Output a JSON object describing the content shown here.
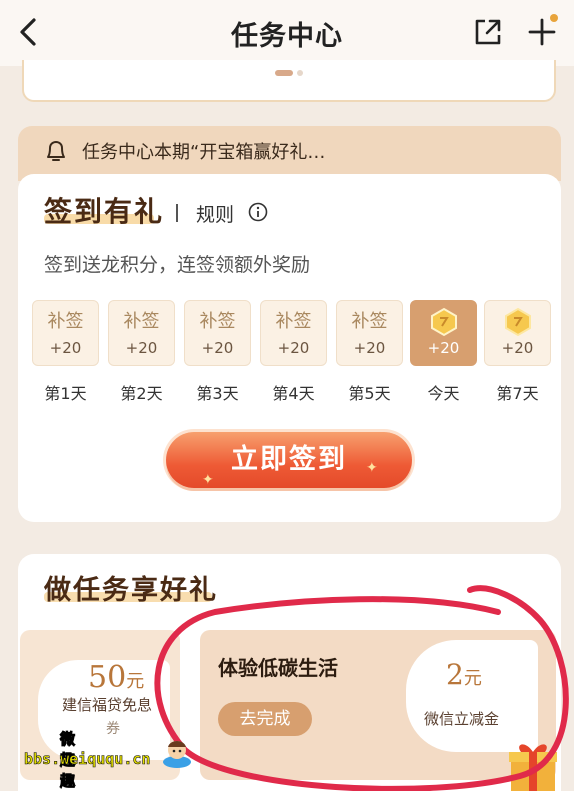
{
  "header": {
    "title": "任务中心"
  },
  "notice": {
    "text": "任务中心本期“开宝箱赢好礼…"
  },
  "sign_in": {
    "title": "签到有礼",
    "rules_label": "规则",
    "subtitle": "签到送龙积分，连签领额外奖励",
    "days": [
      {
        "label": "补签",
        "points": "+20",
        "day": "第1天"
      },
      {
        "label": "补签",
        "points": "+20",
        "day": "第2天"
      },
      {
        "label": "补签",
        "points": "+20",
        "day": "第3天"
      },
      {
        "label": "补签",
        "points": "+20",
        "day": "第4天"
      },
      {
        "label": "补签",
        "points": "+20",
        "day": "第5天"
      },
      {
        "label": "",
        "points": "+20",
        "day": "今天"
      },
      {
        "label": "",
        "points": "+20",
        "day": "第7天"
      }
    ],
    "button_label": "立即签到"
  },
  "tasks": {
    "title": "做任务享好礼",
    "left_coupon": {
      "amount": "50",
      "unit": "元",
      "desc": "建信福贷免息",
      "desc2": "券"
    },
    "main_task": {
      "title": "体验低碳生活",
      "button": "去完成",
      "coupon": {
        "amount": "2",
        "unit": "元",
        "desc": "微信立减金"
      }
    }
  },
  "watermark": {
    "top": "微趣趣",
    "bottom": "bbs.weiququ.cn"
  },
  "colors": {
    "accent": "#d79f6f",
    "sign_button": "#ee5a35",
    "annotation": "#e02a4a"
  }
}
